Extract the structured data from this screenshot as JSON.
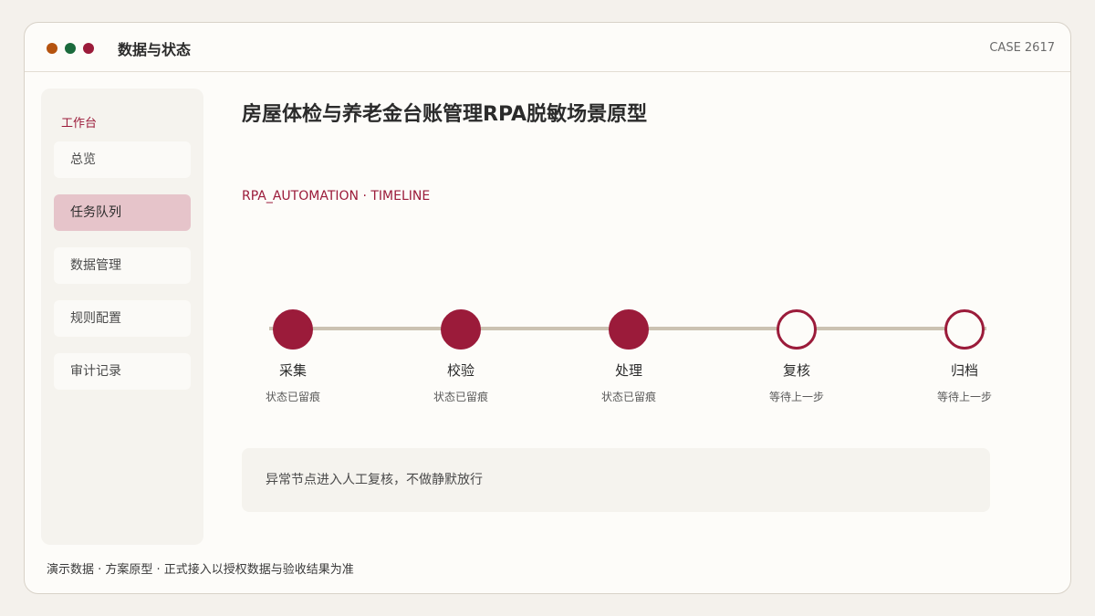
{
  "window": {
    "title": "数据与状态",
    "case_label": "CASE 2617",
    "controls": [
      {
        "name": "close",
        "color": "#b5530f"
      },
      {
        "name": "minimize",
        "color": "#1a6a3c"
      },
      {
        "name": "maximize",
        "color": "#9b1b3a"
      }
    ]
  },
  "sidebar": {
    "heading": "工作台",
    "items": [
      {
        "label": "总览",
        "active": false
      },
      {
        "label": "任务队列",
        "active": true
      },
      {
        "label": "数据管理",
        "active": false
      },
      {
        "label": "规则配置",
        "active": false
      },
      {
        "label": "审计记录",
        "active": false
      }
    ]
  },
  "main": {
    "title": "房屋体检与养老金台账管理RPA脱敏场景原型",
    "subtitle": "RPA_AUTOMATION · TIMELINE",
    "timeline": [
      {
        "label": "采集",
        "status": "状态已留痕",
        "done": true
      },
      {
        "label": "校验",
        "status": "状态已留痕",
        "done": true
      },
      {
        "label": "处理",
        "status": "状态已留痕",
        "done": true
      },
      {
        "label": "复核",
        "status": "等待上一步",
        "done": false
      },
      {
        "label": "归档",
        "status": "等待上一步",
        "done": false
      }
    ],
    "notice": "异常节点进入人工复核，不做静默放行"
  },
  "footer": "演示数据 · 方案原型 · 正式接入以授权数据与验收结果为准",
  "colors": {
    "accent": "#9b1b3a",
    "active_nav": "#e6c4ca",
    "track": "#cbc2b2"
  }
}
